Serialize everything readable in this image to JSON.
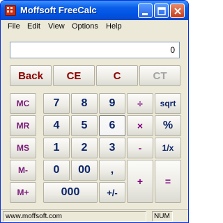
{
  "window": {
    "title": "Moffsoft FreeCalc"
  },
  "menu": [
    "File",
    "Edit",
    "View",
    "Options",
    "Help"
  ],
  "display": {
    "value": "0"
  },
  "top_buttons": [
    "Back",
    "CE",
    "C",
    "CT"
  ],
  "keys": {
    "mc": "MC",
    "mr": "MR",
    "ms": "MS",
    "mminus": "M-",
    "mplus": "M+",
    "seven": "7",
    "eight": "8",
    "nine": "9",
    "divide": "÷",
    "sqrt": "sqrt",
    "four": "4",
    "five": "5",
    "six": "6",
    "multiply": "×",
    "percent": "%",
    "one": "1",
    "two": "2",
    "three": "3",
    "minus": "-",
    "reciprocal": "1/x",
    "zero": "0",
    "double_zero": "00",
    "decimal": ",",
    "plus": "+",
    "equals": "=",
    "triple_zero": "000",
    "plus_minus": "+/-"
  },
  "status": {
    "left": "www.moffsoft.com",
    "right": "NUM"
  }
}
